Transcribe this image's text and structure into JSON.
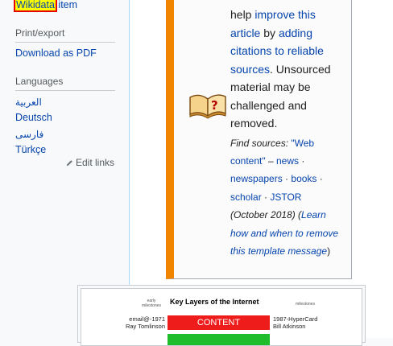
{
  "sidebar": {
    "wikidata_label": "Wikidata",
    "wikidata_suffix": "item",
    "print_export_heading": "Print/export",
    "download_pdf": "Download as PDF",
    "languages_heading": "Languages",
    "languages": [
      "العربية",
      "Deutsch",
      "فارسی",
      "Türkçe"
    ],
    "edit_links": "Edit links"
  },
  "ambox": {
    "icon": "book-question-icon",
    "line_help": "help ",
    "link_improve": "improve this article",
    "text_by": " by ",
    "link_adding": "adding citations to reliable sources",
    "text_unsourced": ". Unsourced material may be challenged and removed.",
    "find_sources_label": "Find sources:",
    "link_web_content": "\"Web content\"",
    "sep_dash": " – ",
    "link_news": "news",
    "link_newspapers": "newspapers",
    "link_books": "books",
    "link_scholar": "scholar",
    "link_jstor": "JSTOR",
    "date_text": "(October 2018) (",
    "link_learn": "Learn how and when to remove this template message",
    "close_paren": ")"
  },
  "figure": {
    "title": "Key Layers of the Internet",
    "left_caption": "early milestones",
    "right_caption": "milestones",
    "left_entry_1": "email@-1971",
    "left_entry_2": "Ray Tomlinson",
    "bar_label": "CONTENT",
    "right_entry_1": "1987-HyperCard",
    "right_entry_2": "Bill Atkinson"
  },
  "colors": {
    "link": "#0645ad",
    "ambox_stripe": "#f28500",
    "highlight": "#ffff00",
    "highlight_border": "#e60000",
    "content_bar": "#ef1c1c"
  }
}
